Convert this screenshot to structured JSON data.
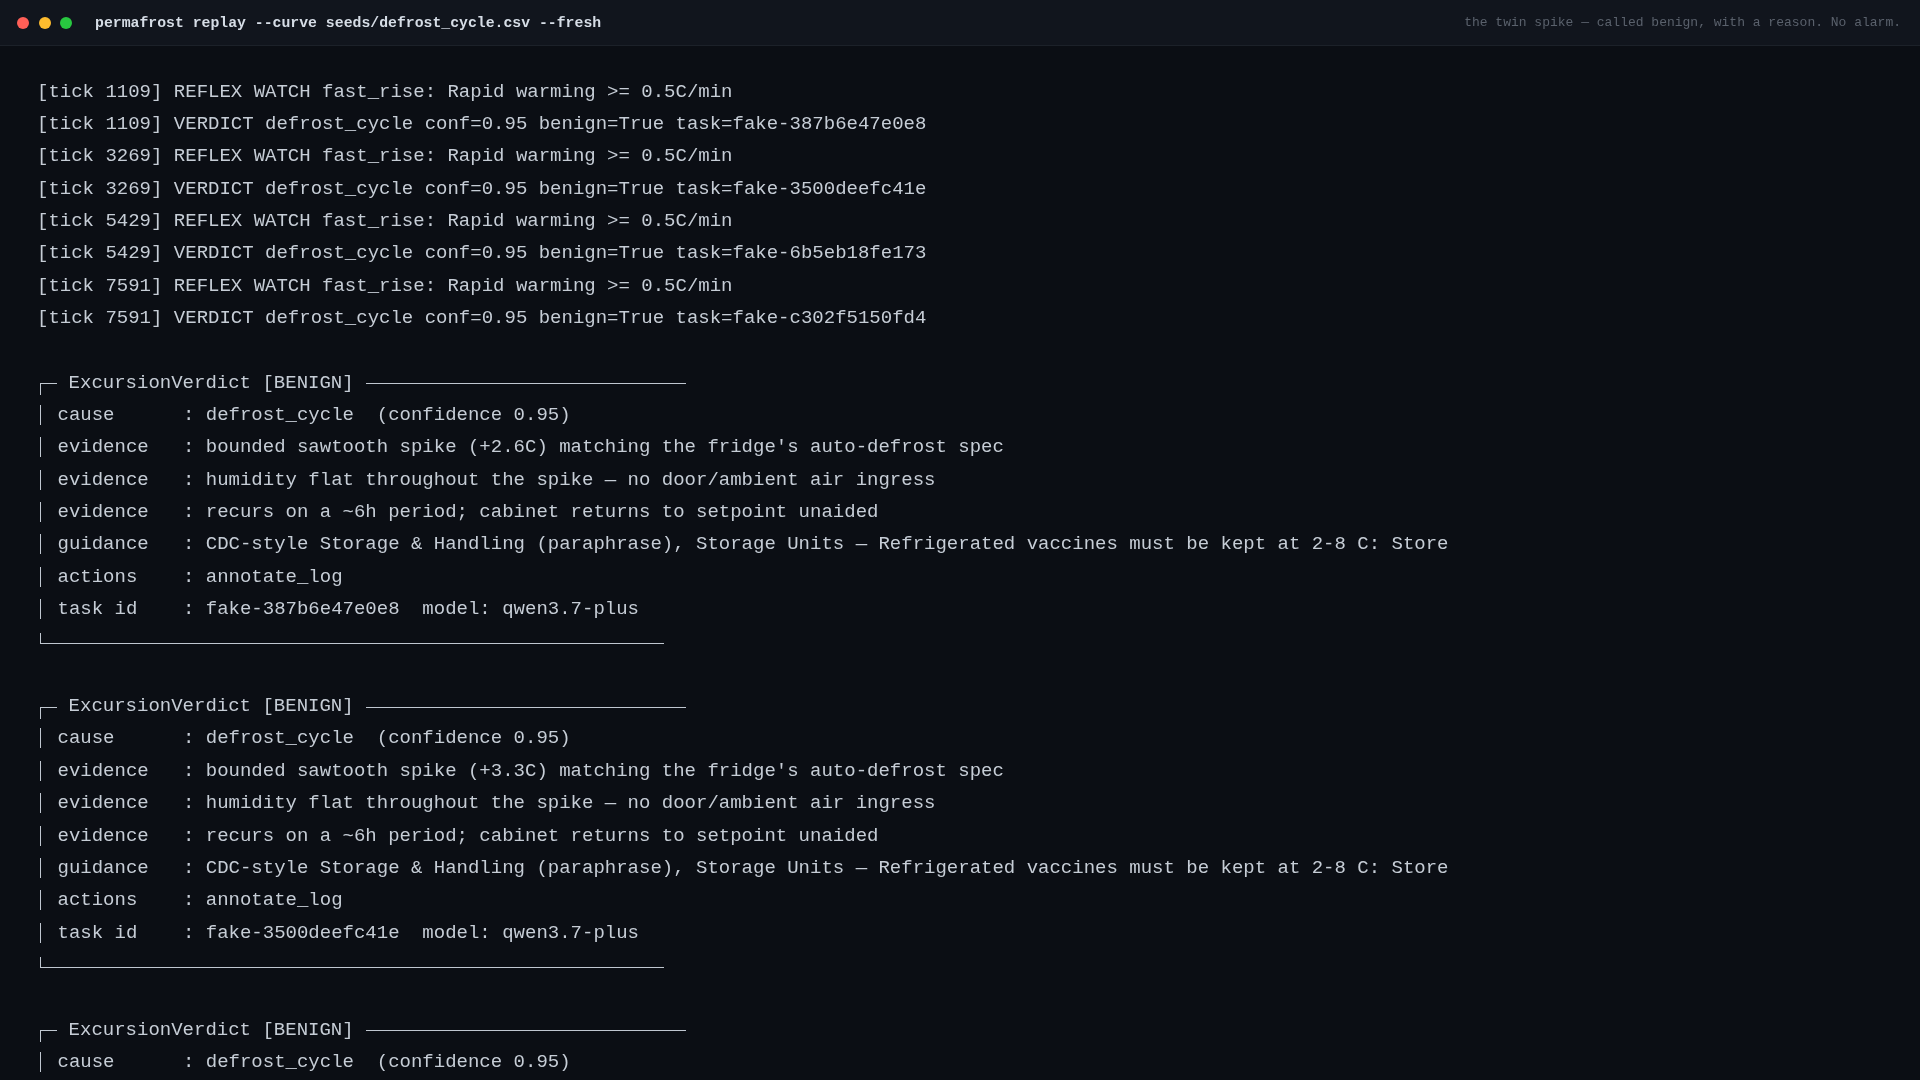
{
  "window": {
    "title": "permafrost replay --curve seeds/defrost_cycle.csv --fresh",
    "caption": "the twin spike — called benign, with a reason. No alarm."
  },
  "log": [
    "[tick 1109] REFLEX WATCH fast_rise: Rapid warming >= 0.5C/min",
    "[tick 1109] VERDICT defrost_cycle conf=0.95 benign=True task=fake-387b6e47e0e8",
    "[tick 3269] REFLEX WATCH fast_rise: Rapid warming >= 0.5C/min",
    "[tick 3269] VERDICT defrost_cycle conf=0.95 benign=True task=fake-3500deefc41e",
    "[tick 5429] REFLEX WATCH fast_rise: Rapid warming >= 0.5C/min",
    "[tick 5429] VERDICT defrost_cycle conf=0.95 benign=True task=fake-6b5eb18fe173",
    "[tick 7591] REFLEX WATCH fast_rise: Rapid warming >= 0.5C/min",
    "[tick 7591] VERDICT defrost_cycle conf=0.95 benign=True task=fake-c302f5150fd4"
  ],
  "verdicts": [
    {
      "title": "ExcursionVerdict [BENIGN]",
      "lines": [
        "cause      : defrost_cycle  (confidence 0.95)",
        "evidence   : bounded sawtooth spike (+2.6C) matching the fridge's auto-defrost spec",
        "evidence   : humidity flat throughout the spike — no door/ambient air ingress",
        "evidence   : recurs on a ~6h period; cabinet returns to setpoint unaided",
        "guidance   : CDC-style Storage & Handling (paraphrase), Storage Units — Refrigerated vaccines must be kept at 2-8 C: Store",
        "actions    : annotate_log",
        "task id    : fake-387b6e47e0e8  model: qwen3.7-plus"
      ]
    },
    {
      "title": "ExcursionVerdict [BENIGN]",
      "lines": [
        "cause      : defrost_cycle  (confidence 0.95)",
        "evidence   : bounded sawtooth spike (+3.3C) matching the fridge's auto-defrost spec",
        "evidence   : humidity flat throughout the spike — no door/ambient air ingress",
        "evidence   : recurs on a ~6h period; cabinet returns to setpoint unaided",
        "guidance   : CDC-style Storage & Handling (paraphrase), Storage Units — Refrigerated vaccines must be kept at 2-8 C: Store",
        "actions    : annotate_log",
        "task id    : fake-3500deefc41e  model: qwen3.7-plus"
      ]
    },
    {
      "title": "ExcursionVerdict [BENIGN]",
      "lines": [
        "cause      : defrost_cycle  (confidence 0.95)"
      ]
    }
  ]
}
